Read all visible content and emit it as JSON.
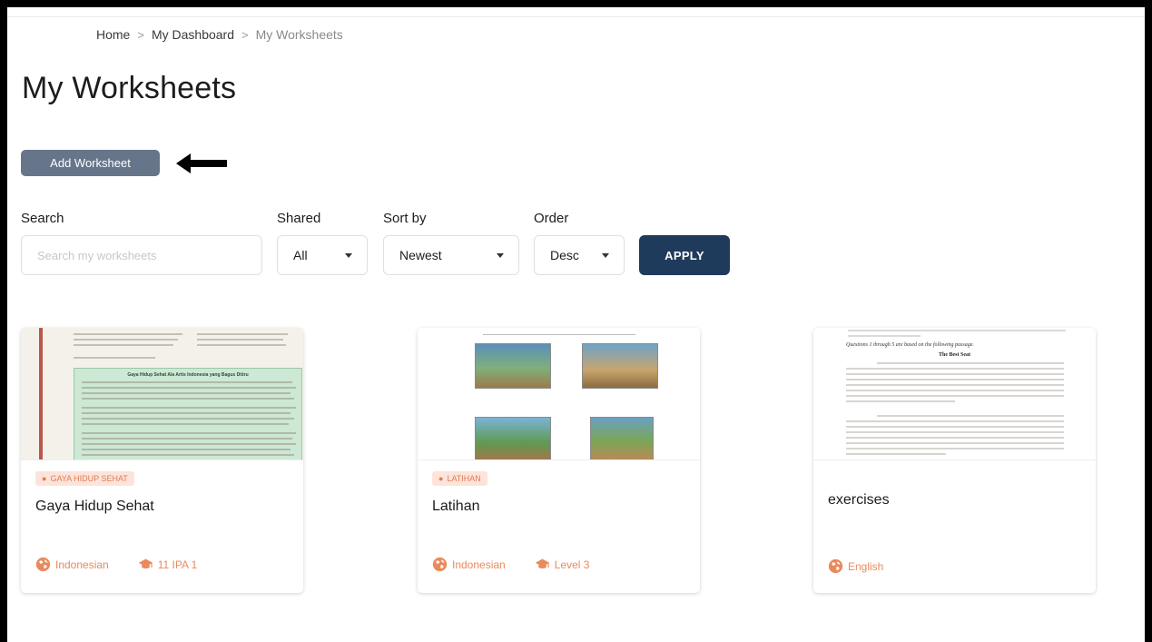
{
  "breadcrumb": {
    "home": "Home",
    "dashboard": "My Dashboard",
    "current": "My Worksheets",
    "separator": ">"
  },
  "page_title": "My Worksheets",
  "add_button_label": "Add Worksheet",
  "filters": {
    "search_label": "Search",
    "search_placeholder": "Search my worksheets",
    "shared_label": "Shared",
    "shared_value": "All",
    "sort_label": "Sort by",
    "sort_value": "Newest",
    "order_label": "Order",
    "order_value": "Desc",
    "apply_label": "APPLY"
  },
  "cards": [
    {
      "tag": "GAYA HIDUP SEHAT",
      "title": "Gaya Hidup Sehat",
      "language": "Indonesian",
      "level": "11 IPA 1",
      "thumb_heading": "Gaya Hidup Sehat Ala Artis Indonesia yang Bagus Ditiru"
    },
    {
      "tag": "LATIHAN",
      "title": "Latihan",
      "language": "Indonesian",
      "level": "Level 3"
    },
    {
      "tag": "",
      "title": "exercises",
      "language": "English",
      "level": "",
      "thumb_heading": "The Best Seat",
      "thumb_intro": "Questions 1 through 5 are based on the following passage."
    }
  ],
  "colors": {
    "accent": "#e98a5c",
    "tag_bg": "#fde4da",
    "apply_bg": "#1f3b5b",
    "add_bg": "#67758a"
  },
  "icons": {
    "language": "globe-icon",
    "level": "graduation-cap-icon",
    "dropdown": "chevron-down-icon",
    "annotation": "left-arrow-icon"
  }
}
